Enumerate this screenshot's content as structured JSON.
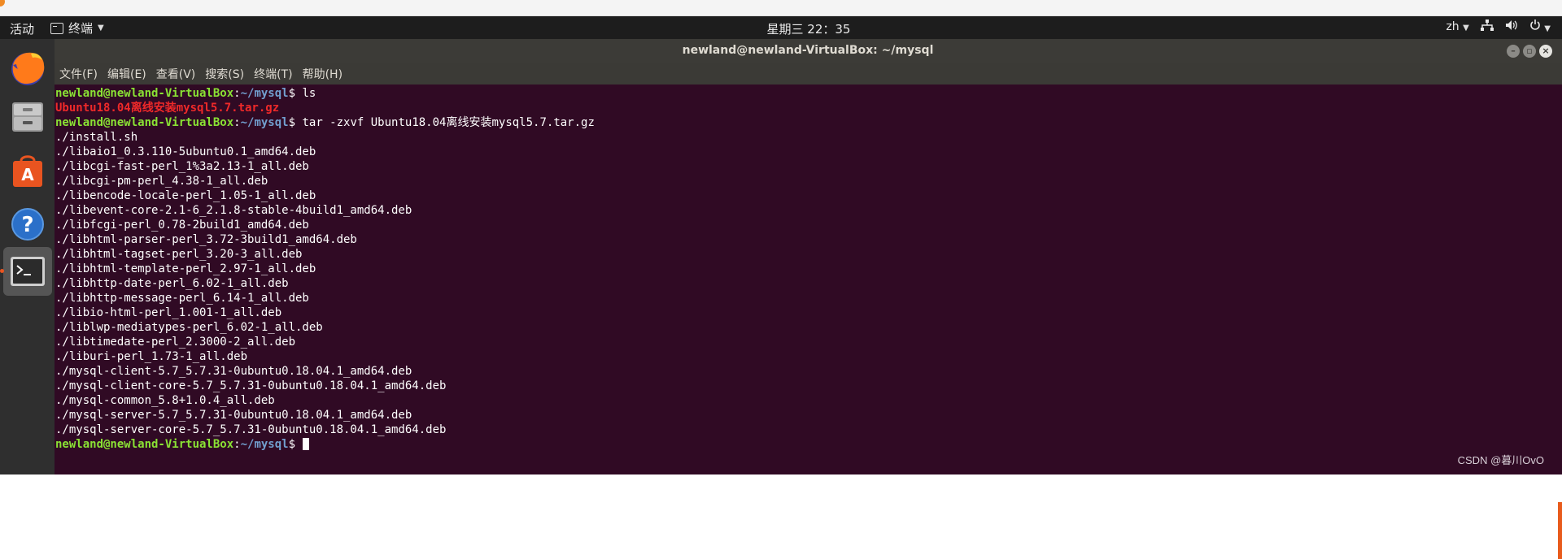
{
  "topbar": {
    "activities": "活动",
    "app_name": "终端",
    "clock": "星期三 22：35",
    "input_method": "zh"
  },
  "window": {
    "title": "newland@newland-VirtualBox: ~/mysql"
  },
  "menubar": {
    "items": [
      "文件(F)",
      "编辑(E)",
      "查看(V)",
      "搜索(S)",
      "终端(T)",
      "帮助(H)"
    ]
  },
  "terminal": {
    "prompt_user": "newland@newland-VirtualBox",
    "prompt_path": "~/mysql",
    "cmd1": "ls",
    "ls_output": "Ubuntu18.04离线安装mysql5.7.tar.gz",
    "cmd2": "tar -zxvf Ubuntu18.04离线安装mysql5.7.tar.gz",
    "files": [
      "./install.sh",
      "./libaio1_0.3.110-5ubuntu0.1_amd64.deb",
      "./libcgi-fast-perl_1%3a2.13-1_all.deb",
      "./libcgi-pm-perl_4.38-1_all.deb",
      "./libencode-locale-perl_1.05-1_all.deb",
      "./libevent-core-2.1-6_2.1.8-stable-4build1_amd64.deb",
      "./libfcgi-perl_0.78-2build1_amd64.deb",
      "./libhtml-parser-perl_3.72-3build1_amd64.deb",
      "./libhtml-tagset-perl_3.20-3_all.deb",
      "./libhtml-template-perl_2.97-1_all.deb",
      "./libhttp-date-perl_6.02-1_all.deb",
      "./libhttp-message-perl_6.14-1_all.deb",
      "./libio-html-perl_1.001-1_all.deb",
      "./liblwp-mediatypes-perl_6.02-1_all.deb",
      "./libtimedate-perl_2.3000-2_all.deb",
      "./liburi-perl_1.73-1_all.deb",
      "./mysql-client-5.7_5.7.31-0ubuntu0.18.04.1_amd64.deb",
      "./mysql-client-core-5.7_5.7.31-0ubuntu0.18.04.1_amd64.deb",
      "./mysql-common_5.8+1.0.4_all.deb",
      "./mysql-server-5.7_5.7.31-0ubuntu0.18.04.1_amd64.deb",
      "./mysql-server-core-5.7_5.7.31-0ubuntu0.18.04.1_amd64.deb"
    ]
  },
  "watermark": "CSDN @暮川OvO",
  "dock": {
    "items": [
      "firefox-icon",
      "files-icon",
      "software-center-icon",
      "help-icon",
      "terminal-icon"
    ]
  },
  "colors": {
    "terminal_bg": "#300a24",
    "prompt_user": "#8ae234",
    "prompt_path": "#729fcf",
    "archive_red": "#ef2929",
    "accent": "#e95420"
  }
}
